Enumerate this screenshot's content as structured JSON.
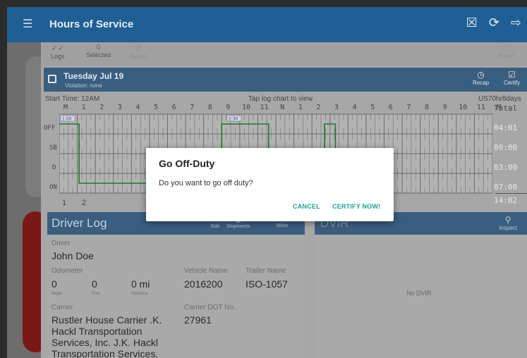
{
  "appbar": {
    "title": "Hours of Service",
    "menu_icon": "hamburger-icon",
    "actions": [
      "close-box-icon",
      "refresh-icon",
      "logout-icon"
    ]
  },
  "toolbar": {
    "logs_label": "Logs",
    "selected_count": "0",
    "selected_label": "Selected",
    "reset_label": "Reset",
    "email_label": "Email"
  },
  "day": {
    "date": "Tuesday Jul 19",
    "violation": "Violation: none",
    "recap_label": "Recap",
    "certify_label": "Certify"
  },
  "chart_info": {
    "start_time": "Start Time: 12AM",
    "hint": "Tap log chart to view",
    "ruleset": "US70hr8days"
  },
  "log_chart": {
    "hour_labels": [
      "M",
      "1",
      "2",
      "3",
      "4",
      "5",
      "6",
      "7",
      "8",
      "9",
      "10",
      "11",
      "N",
      "1",
      "2",
      "3",
      "4",
      "5",
      "6",
      "7",
      "8",
      "9",
      "10",
      "11",
      "M"
    ],
    "total_label": "Total",
    "rows": [
      "OFF",
      "SB",
      "D",
      "ON"
    ],
    "totals": [
      "04:01",
      "00:00",
      "03:00",
      "07:00"
    ],
    "grand_total": "14:02",
    "bottom_labels": [
      "1",
      "2"
    ],
    "badge_1": "1:00",
    "badge_2": "2:30",
    "badge_3": "7:0"
  },
  "driver_log": {
    "title": "Driver Log",
    "edit_label": "Edit",
    "shipments_label": "Shipments",
    "miles_label": "Miles",
    "driver_label": "Driver",
    "driver_name": "John Doe",
    "odometer_label": "Odometer",
    "odo_begin": "0",
    "odo_end": "0",
    "odo_distance": "0 mi",
    "begin_label": "Begin",
    "end_label": "End",
    "distance_label": "Distance",
    "vehicle_label": "Vehicle Name",
    "vehicle_name": "2016200",
    "trailer_label": "Trailer Name",
    "trailer_name": "ISO-1057",
    "carrier_label": "Carrier",
    "carrier_line1": "Rustler House Carrier .K.",
    "carrier_line2": "Hackl Transportation",
    "carrier_line3": "Services, Inc. J.K. Hackl",
    "carrier_line4": "Transportation Services,",
    "dot_label": "Carrier DOT No.",
    "dot_number": "27961"
  },
  "dvir": {
    "title": "DVIR",
    "inspect_label": "Inspect",
    "empty_text": "No DVIR"
  },
  "dialog": {
    "title": "Go Off-Duty",
    "message": "Do you want to go off duty?",
    "cancel_label": "CANCEL",
    "certify_label": "CERTIFY NOW!"
  }
}
